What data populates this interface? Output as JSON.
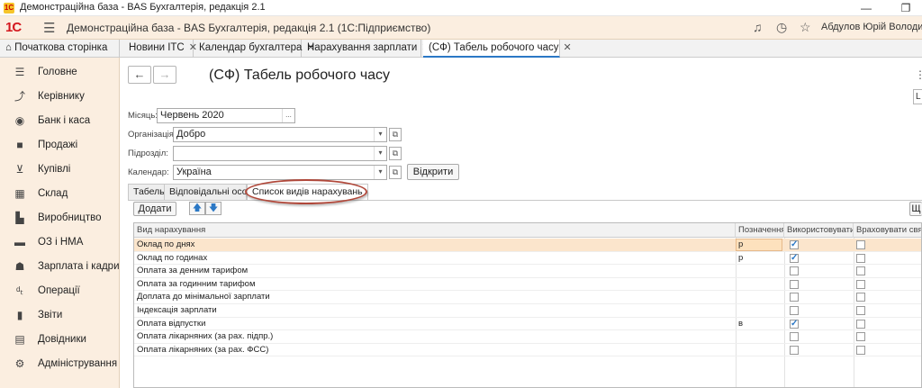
{
  "window": {
    "title": "Демонстраційна база - BAS Бухгалтерія, редакція 2.1",
    "logo": "1С",
    "controls": [
      "minimize-icon",
      "restore-icon"
    ]
  },
  "app": {
    "brand": "1С",
    "title": "Демонстраційна база - BAS Бухгалтерія, редакція 2.1  (1С:Підприємство)",
    "user": "Абдулов Юрій Володимирович"
  },
  "tabs": [
    {
      "label": "Початкова сторінка",
      "icon": "home-icon",
      "closable": false
    },
    {
      "label": "Новини ITC"
    },
    {
      "label": "Календар бухгалтера"
    },
    {
      "label": "Нарахування зарплати"
    },
    {
      "label": "(СФ) Табель робочого часу",
      "active": true
    }
  ],
  "sidebar": [
    {
      "label": "Головне",
      "icon": "list-icon"
    },
    {
      "label": "Керівнику",
      "icon": "trend-icon"
    },
    {
      "label": "Банк і каса",
      "icon": "bank-icon"
    },
    {
      "label": "Продажі",
      "icon": "bag-icon"
    },
    {
      "label": "Купівлі",
      "icon": "cart-icon"
    },
    {
      "label": "Склад",
      "icon": "warehouse-icon"
    },
    {
      "label": "Виробництво",
      "icon": "factory-icon"
    },
    {
      "label": "ОЗ і НМА",
      "icon": "truck-icon"
    },
    {
      "label": "Зарплата і кадри",
      "icon": "people-icon"
    },
    {
      "label": "Операції",
      "icon": "operations-icon"
    },
    {
      "label": "Звіти",
      "icon": "reports-icon"
    },
    {
      "label": "Довідники",
      "icon": "book-icon"
    },
    {
      "label": "Адміністрування",
      "icon": "gear-icon"
    }
  ],
  "form": {
    "title": "(СФ) Табель робочого часу",
    "month_label": "Місяць:",
    "month_value": "Червень 2020",
    "org_label": "Організація:",
    "org_value": "Добро",
    "dept_label": "Підрозділ:",
    "dept_value": "",
    "calendar_label": "Календар:",
    "calendar_value": "Україна",
    "open_button": "Відкрити",
    "right_box": "L",
    "more_icon": "⋮"
  },
  "form_tabs": [
    {
      "label": "Табель"
    },
    {
      "label": "Відповідальні особи"
    },
    {
      "label": "Список видів нарахувань",
      "active": true
    }
  ],
  "toolbar": {
    "add_button": "Додати",
    "right_button": "Щ"
  },
  "table": {
    "columns": [
      "Вид нарахування",
      "Позначення",
      "Використовувати",
      "Враховувати святкові дні"
    ],
    "rows": [
      {
        "name": "Оклад по днях",
        "code": "р",
        "use": true,
        "holidays": false,
        "selected": true
      },
      {
        "name": "Оклад по годинах",
        "code": "р",
        "use": true,
        "holidays": false
      },
      {
        "name": "Оплата за денним тарифом",
        "code": "",
        "use": false,
        "holidays": false
      },
      {
        "name": "Оплата за годинним тарифом",
        "code": "",
        "use": false,
        "holidays": false
      },
      {
        "name": "Доплата до мінімальної зарплати",
        "code": "",
        "use": false,
        "holidays": false
      },
      {
        "name": "Індексація зарплати",
        "code": "",
        "use": false,
        "holidays": false
      },
      {
        "name": "Оплата відпустки",
        "code": "в",
        "use": true,
        "holidays": false
      },
      {
        "name": "Оплата лікарняних (за рах. підпр.)",
        "code": "",
        "use": false,
        "holidays": false
      },
      {
        "name": "Оплата лікарняних (за рах. ФСС)",
        "code": "",
        "use": false,
        "holidays": false
      }
    ]
  },
  "colors": {
    "accent": "#2b78c5",
    "sidebar_bg": "#fbeee0",
    "brand_red": "#d4181e",
    "selected_row": "#fbe5cc",
    "annotation": "#b0483a"
  }
}
